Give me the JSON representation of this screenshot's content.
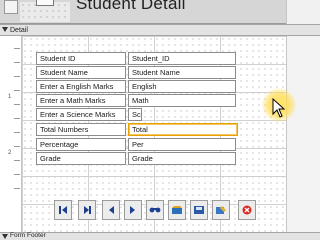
{
  "form": {
    "title": "Student Detail"
  },
  "sections": {
    "detail": "Detail",
    "footer": "Form Footer"
  },
  "rows": [
    {
      "label": "Student ID",
      "field": "Student_ID"
    },
    {
      "label": "Student Name",
      "field": "Student Name"
    },
    {
      "label": "Enter a English Marks",
      "field": "English"
    },
    {
      "label": "Enter a Math Marks",
      "field": "Math"
    },
    {
      "label": "Enter a Science Marks",
      "field": "Sc"
    },
    {
      "label": "Total Numbers",
      "field": "Total"
    },
    {
      "label": "Percentage",
      "field": "Per"
    },
    {
      "label": "Grade",
      "field": "Grade"
    }
  ],
  "ruler": [
    "1",
    "2"
  ],
  "nav_buttons": [
    "first-record-icon",
    "next-record-icon",
    "previous-record-icon",
    "last-record-icon",
    "find-record-icon",
    "add-record-icon",
    "save-record-icon",
    "edit-record-icon",
    "delete-record-icon"
  ],
  "colors": {
    "selection": "#e8a100",
    "cursor_glow": "#ffe25a",
    "section_bar": "#e3e3e3"
  }
}
